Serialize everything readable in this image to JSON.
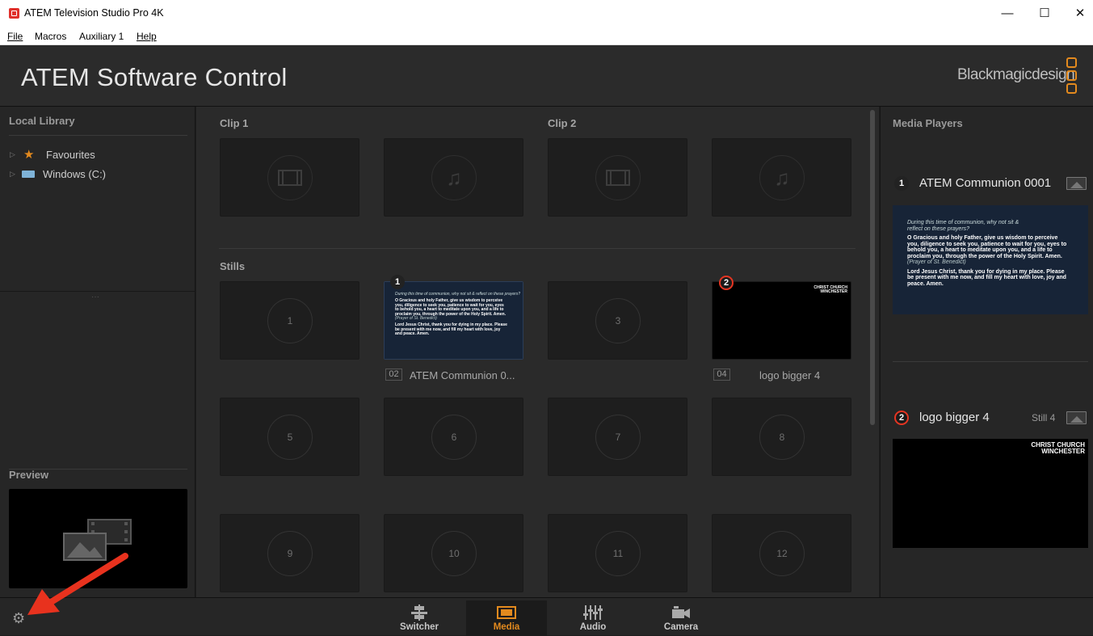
{
  "window": {
    "title": "ATEM Television Studio Pro 4K",
    "controls": {
      "minimize": "—",
      "maximize": "☐",
      "close": "✕"
    }
  },
  "menu": [
    "File",
    "Macros",
    "Auxiliary 1",
    "Help"
  ],
  "header": {
    "title": "ATEM Software Control",
    "brand": "Blackmagicdesign"
  },
  "library": {
    "heading": "Local Library",
    "items": [
      {
        "label": "Favourites",
        "icon": "star-icon"
      },
      {
        "label": "Windows (C:)",
        "icon": "drive-icon"
      }
    ],
    "preview_heading": "Preview"
  },
  "media_pool": {
    "clip1_label": "Clip 1",
    "clip2_label": "Clip 2",
    "stills_label": "Stills",
    "stills": [
      {
        "n": "1"
      },
      {
        "badge": "1",
        "caption_num": "02",
        "caption": "ATEM Communion 0..."
      },
      {
        "n": "3"
      },
      {
        "badge": "2",
        "caption_num": "04",
        "caption": "logo bigger 4"
      },
      {
        "n": "5"
      },
      {
        "n": "6"
      },
      {
        "n": "7"
      },
      {
        "n": "8"
      },
      {
        "n": "9"
      },
      {
        "n": "10"
      },
      {
        "n": "11"
      },
      {
        "n": "12"
      }
    ]
  },
  "slide": {
    "intro": "During this time of communion, why not sit & reflect on these prayers?",
    "prayer1": "O Gracious and holy Father, give us wisdom to perceive you, diligence to seek you, patience to wait for you, eyes to behold you, a heart to meditate upon you, and a life to proclaim you, through the power of the Holy Spirit. Amen.",
    "credit": "(Prayer of St. Benedict)",
    "prayer2": "Lord Jesus Christ, thank you for dying in my place. Please be present with me now, and fill my heart with love, joy and peace. Amen.",
    "logo_line1": "CHRIST CHURCH",
    "logo_line2": "WINCHESTER"
  },
  "media_players": {
    "heading": "Media Players",
    "players": [
      {
        "num": "1",
        "name": "ATEM Communion 0001",
        "still": ""
      },
      {
        "num": "2",
        "name": "logo bigger 4",
        "still": "Still 4"
      }
    ]
  },
  "nav": [
    {
      "label": "Switcher",
      "icon": "switcher-icon"
    },
    {
      "label": "Media",
      "icon": "media-icon",
      "active": true
    },
    {
      "label": "Audio",
      "icon": "audio-icon"
    },
    {
      "label": "Camera",
      "icon": "camera-icon"
    }
  ],
  "colors": {
    "accent": "#e38a1e",
    "badge_red": "#e53522",
    "annotation_arrow": "#e8321e"
  }
}
